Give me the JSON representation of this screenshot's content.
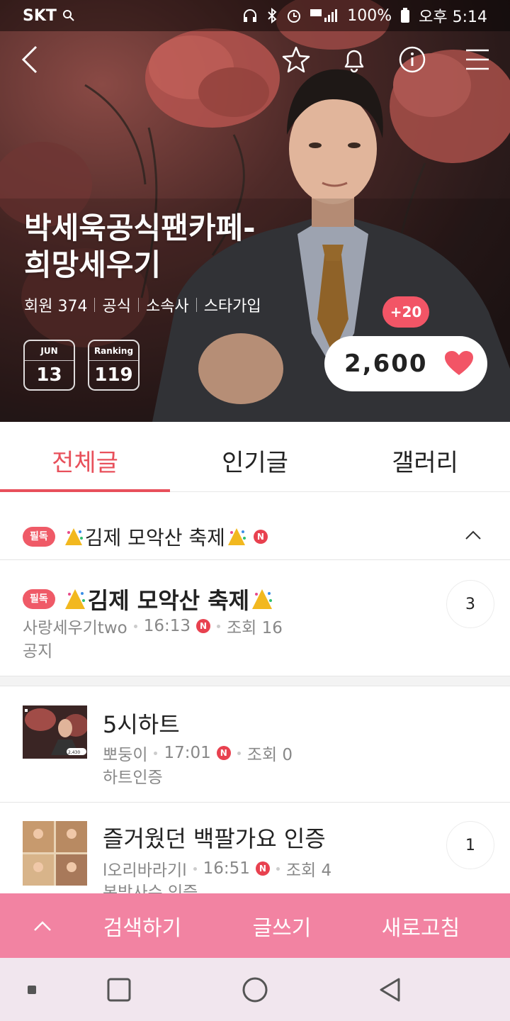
{
  "status_bar": {
    "carrier": "SKT",
    "battery": "100%",
    "time": "오후 5:14"
  },
  "cafe": {
    "title_line1": "박세욱공식팬카페-",
    "title_line2": "희망세우기",
    "meta": [
      "회원 374",
      "공식",
      "소속사",
      "스타가입"
    ],
    "month_label": "JUN",
    "month_value": "13",
    "ranking_label": "Ranking",
    "ranking_value": "119",
    "plus_badge": "+20",
    "heart_count": "2,600"
  },
  "tabs": [
    {
      "label": "전체글",
      "active": true
    },
    {
      "label": "인기글",
      "active": false
    },
    {
      "label": "갤러리",
      "active": false
    }
  ],
  "pinned_bar": {
    "tag": "필독",
    "title": "김제 모악산 축제",
    "new_badge": "N"
  },
  "posts": [
    {
      "tag": "필독",
      "title": "김제 모악산 축제",
      "author": "사랑세우기two",
      "time": "16:13",
      "new_badge": "N",
      "views": "조회 16",
      "category": "공지",
      "comments": "3"
    },
    {
      "title": "5시하트",
      "author": "뽀둥이",
      "time": "17:01",
      "new_badge": "N",
      "views": "조회 0",
      "category": "하트인증",
      "comments": ""
    },
    {
      "title": "즐거웠던 백팔가요 인증",
      "author": "l오리바라기l",
      "time": "16:51",
      "new_badge": "N",
      "views": "조회 4",
      "category": "본방사수 인증",
      "comments": "1"
    }
  ],
  "thumb_text": {
    "heart": "2,430"
  },
  "action_bar": {
    "search": "검색하기",
    "write": "글쓰기",
    "refresh": "새로고침"
  },
  "colors": {
    "accent": "#e8505b",
    "action_bar": "#f283a2",
    "tag": "#ef5a67",
    "heart": "#f25566"
  }
}
